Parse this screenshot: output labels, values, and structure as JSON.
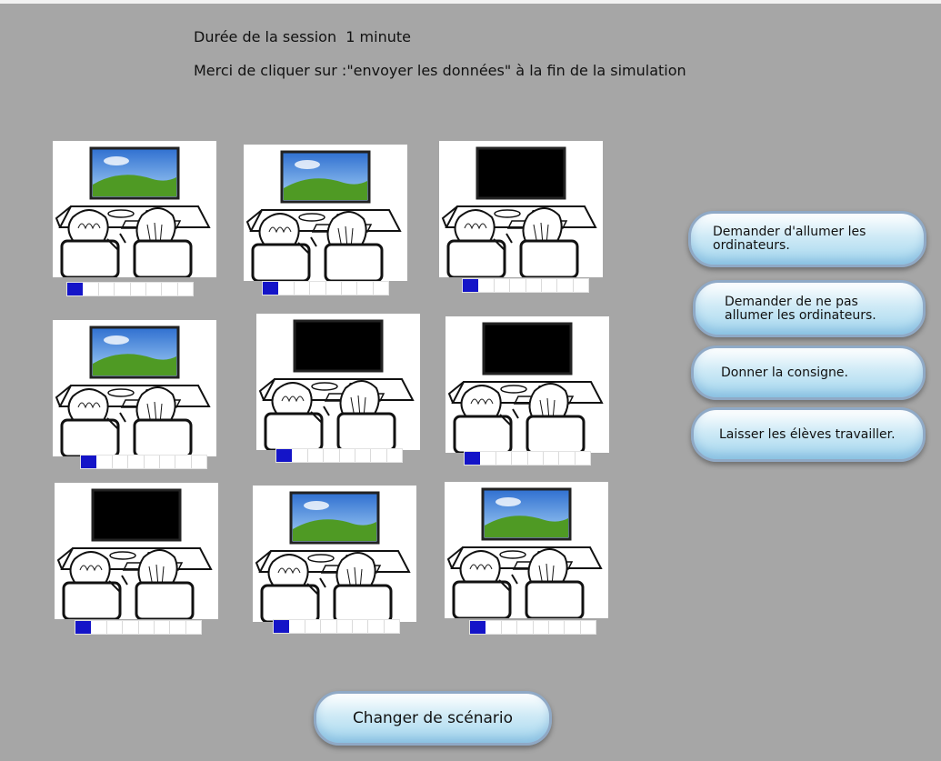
{
  "session": {
    "duration_text": "Durée de la session  1 minute",
    "instruction_text": "Merci de cliquer sur :\"envoyer les données\" à la fin de la simulation"
  },
  "stations": [
    {
      "screen": "on",
      "progress": 0.125
    },
    {
      "screen": "on",
      "progress": 0.125
    },
    {
      "screen": "off",
      "progress": 0.125
    },
    {
      "screen": "on",
      "progress": 0.125
    },
    {
      "screen": "off",
      "progress": 0.125
    },
    {
      "screen": "off",
      "progress": 0.125
    },
    {
      "screen": "off",
      "progress": 0.125
    },
    {
      "screen": "on",
      "progress": 0.125
    },
    {
      "screen": "on",
      "progress": 0.125
    }
  ],
  "actions": {
    "allumer": "Demander d'allumer les ordinateurs.",
    "ne_pas_allumer": "Demander de ne pas allumer les ordinateurs.",
    "consigne": "Donner la consigne.",
    "travailler": "Laisser les élèves travailler.",
    "changer": "Changer de scénario"
  },
  "colors": {
    "background": "#a6a6a6",
    "progress_fill": "#1414c8",
    "button_fill": "#a3d6ee",
    "screen_off": "#000000",
    "sky": "#2f6fd0",
    "hill": "#4f9a24"
  }
}
